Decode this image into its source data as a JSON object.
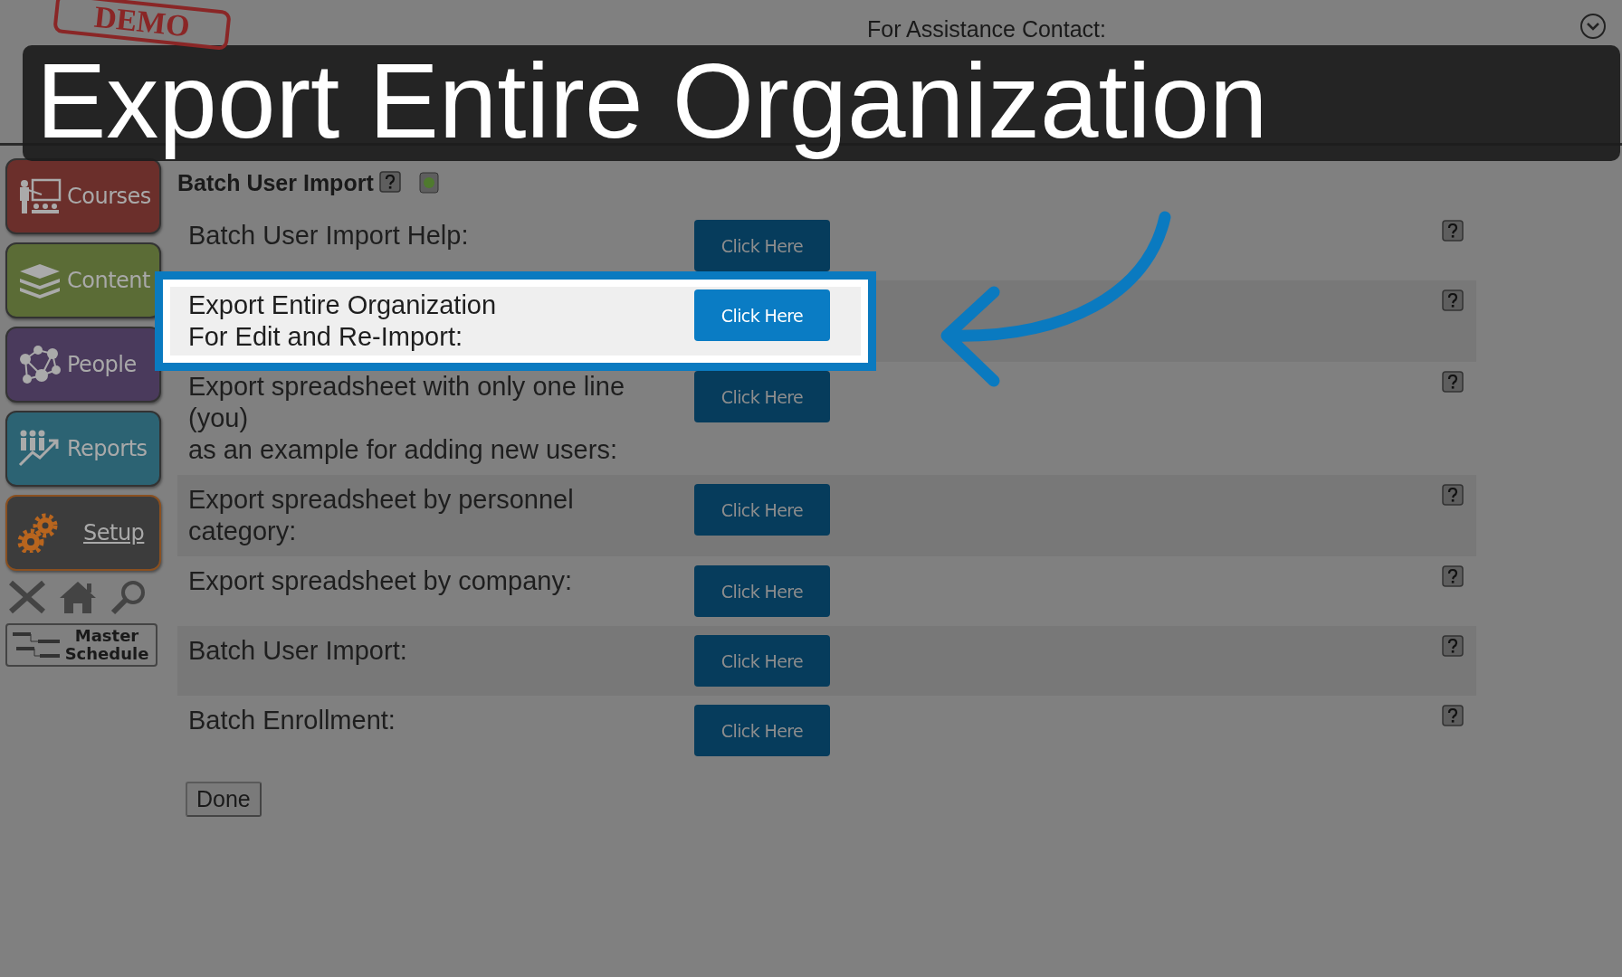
{
  "header": {
    "stamp": "DEMO",
    "assistance_label": "For Assistance Contact:"
  },
  "overlay": {
    "title": "Export Entire Organization"
  },
  "sidebar": {
    "items": [
      {
        "label": "Courses",
        "kind": "courses",
        "selected": false
      },
      {
        "label": "Content",
        "kind": "content",
        "selected": false
      },
      {
        "label": "People",
        "kind": "people",
        "selected": false
      },
      {
        "label": "Reports",
        "kind": "reports",
        "selected": false
      },
      {
        "label": "Setup",
        "kind": "setup",
        "selected": true
      }
    ],
    "master_schedule": "Master Schedule"
  },
  "page": {
    "title": "Batch User Import",
    "rows": [
      {
        "label": "Batch User Import Help:",
        "button": "Click Here",
        "highlighted": false
      },
      {
        "label": "Export Entire Organization\nFor Edit and Re-Import:",
        "button": "Click Here",
        "highlighted": true
      },
      {
        "label": "Export spreadsheet with only one line\n(you)\nas an example for adding new users:",
        "button": "Click Here",
        "highlighted": false
      },
      {
        "label": "Export spreadsheet by personnel\ncategory:",
        "button": "Click Here",
        "highlighted": false
      },
      {
        "label": "Export spreadsheet by company:",
        "button": "Click Here",
        "highlighted": false
      },
      {
        "label": "Batch User Import:",
        "button": "Click Here",
        "highlighted": false
      },
      {
        "label": "Batch Enrollment:",
        "button": "Click Here",
        "highlighted": false
      }
    ],
    "done": "Done"
  }
}
